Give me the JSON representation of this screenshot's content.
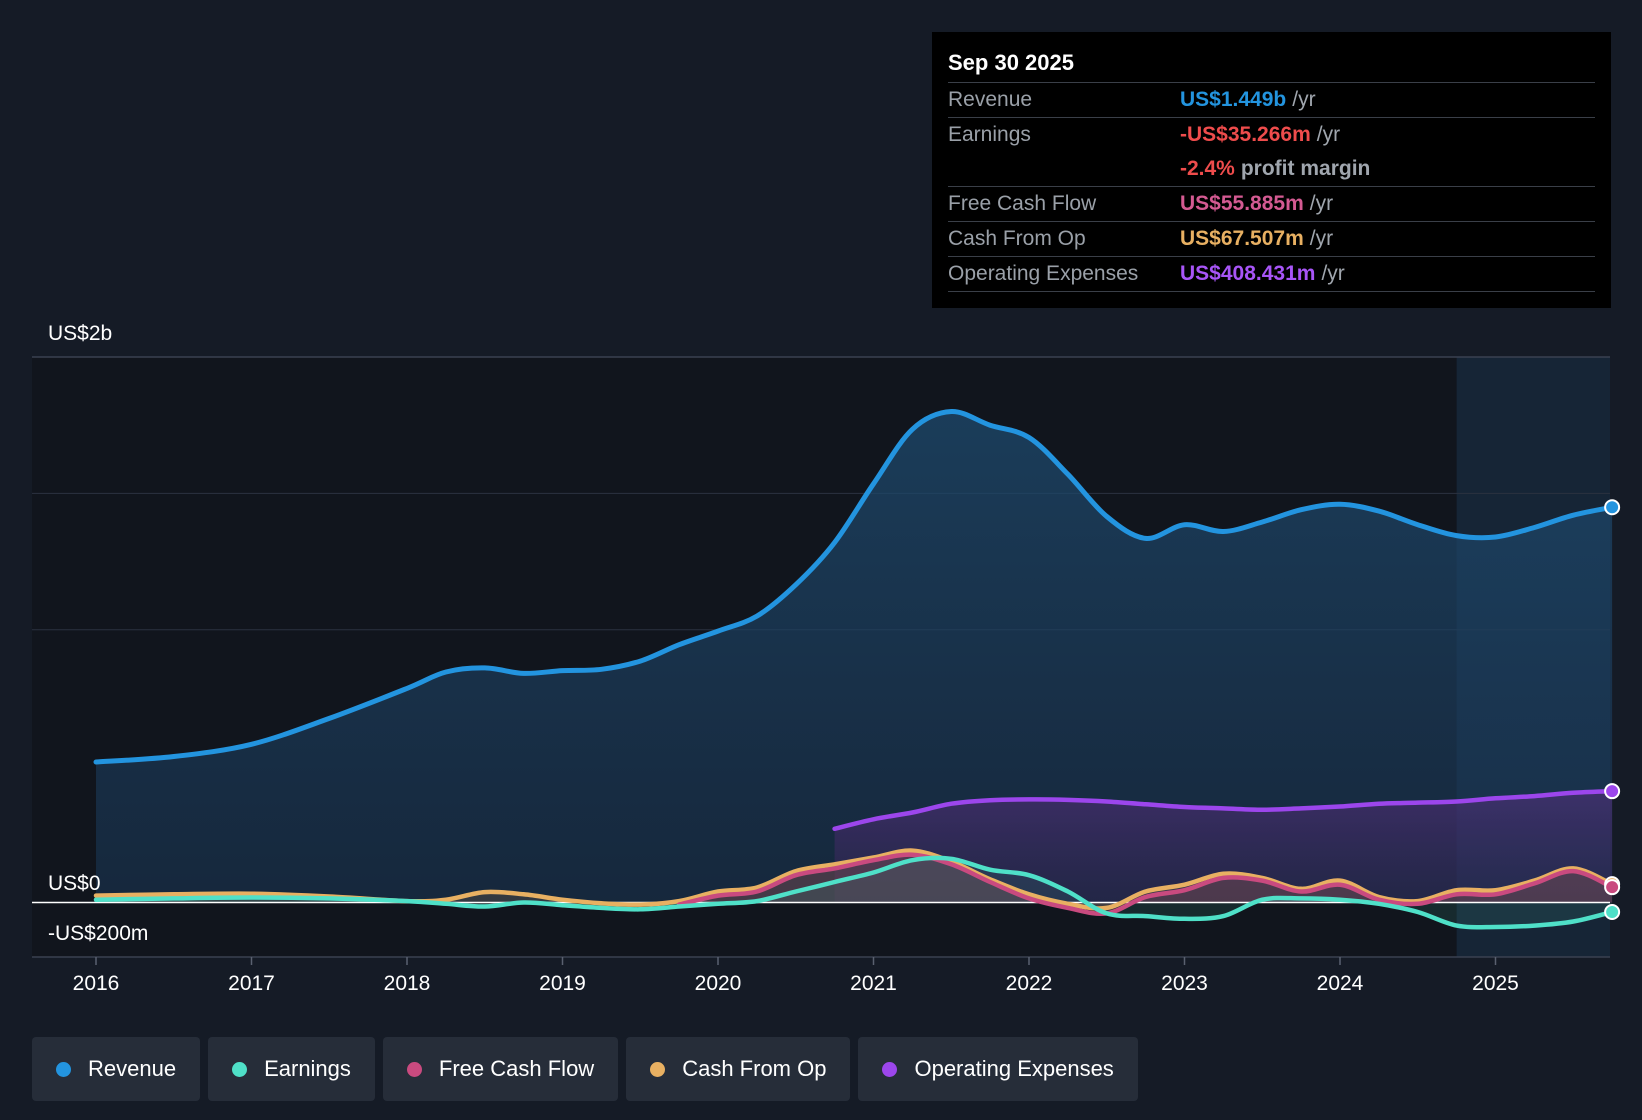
{
  "tooltip": {
    "date": "Sep 30 2025",
    "unit": "/yr",
    "rows": {
      "revenue": {
        "label": "Revenue",
        "value": "US$1.449b"
      },
      "earnings": {
        "label": "Earnings",
        "value": "-US$35.266m"
      },
      "margin": {
        "value": "-2.4%",
        "text": "profit margin"
      },
      "fcf": {
        "label": "Free Cash Flow",
        "value": "US$55.885m"
      },
      "cfo": {
        "label": "Cash From Op",
        "value": "US$67.507m"
      },
      "opex": {
        "label": "Operating Expenses",
        "value": "US$408.431m"
      }
    }
  },
  "legend": {
    "revenue": "Revenue",
    "earnings": "Earnings",
    "fcf": "Free Cash Flow",
    "cfo": "Cash From Op",
    "opex": "Operating Expenses"
  },
  "colors": {
    "revenue": "#2394df",
    "earnings": "#4fe0c8",
    "fcf": "#c94a7f",
    "cfo": "#e8b062",
    "opex": "#9c46ec"
  },
  "chart_data": {
    "type": "area",
    "y_axis_labels": {
      "top": "US$2b",
      "zero": "US$0",
      "bottom": "-US$200m"
    },
    "ylim": [
      -200,
      2000
    ],
    "units": "US$ millions (trailing twelve months)",
    "x_ticks": [
      "2016",
      "2017",
      "2018",
      "2019",
      "2020",
      "2021",
      "2022",
      "2023",
      "2024",
      "2025"
    ],
    "forecast_region_start": 2024.75,
    "grid": true,
    "series": [
      {
        "key": "revenue",
        "name": "Revenue",
        "points": [
          [
            2016.0,
            515
          ],
          [
            2016.5,
            535
          ],
          [
            2017.0,
            580
          ],
          [
            2017.5,
            675
          ],
          [
            2018.0,
            785
          ],
          [
            2018.25,
            845
          ],
          [
            2018.5,
            860
          ],
          [
            2018.75,
            840
          ],
          [
            2019.0,
            850
          ],
          [
            2019.25,
            855
          ],
          [
            2019.5,
            885
          ],
          [
            2019.75,
            945
          ],
          [
            2020.0,
            995
          ],
          [
            2020.25,
            1050
          ],
          [
            2020.5,
            1165
          ],
          [
            2020.75,
            1320
          ],
          [
            2021.0,
            1535
          ],
          [
            2021.25,
            1735
          ],
          [
            2021.5,
            1800
          ],
          [
            2021.75,
            1750
          ],
          [
            2022.0,
            1705
          ],
          [
            2022.25,
            1570
          ],
          [
            2022.5,
            1415
          ],
          [
            2022.75,
            1335
          ],
          [
            2023.0,
            1385
          ],
          [
            2023.25,
            1360
          ],
          [
            2023.5,
            1395
          ],
          [
            2023.75,
            1440
          ],
          [
            2024.0,
            1460
          ],
          [
            2024.25,
            1435
          ],
          [
            2024.5,
            1385
          ],
          [
            2024.75,
            1345
          ],
          [
            2025.0,
            1340
          ],
          [
            2025.25,
            1375
          ],
          [
            2025.5,
            1420
          ],
          [
            2025.75,
            1449
          ]
        ]
      },
      {
        "key": "opex",
        "name": "Operating Expenses",
        "points": [
          [
            2020.75,
            270
          ],
          [
            2021.0,
            305
          ],
          [
            2021.25,
            330
          ],
          [
            2021.5,
            362
          ],
          [
            2021.75,
            375
          ],
          [
            2022.0,
            378
          ],
          [
            2022.25,
            376
          ],
          [
            2022.5,
            370
          ],
          [
            2022.75,
            360
          ],
          [
            2023.0,
            350
          ],
          [
            2023.25,
            345
          ],
          [
            2023.5,
            340
          ],
          [
            2023.75,
            345
          ],
          [
            2024.0,
            352
          ],
          [
            2024.25,
            362
          ],
          [
            2024.5,
            366
          ],
          [
            2024.75,
            370
          ],
          [
            2025.0,
            382
          ],
          [
            2025.25,
            390
          ],
          [
            2025.5,
            402
          ],
          [
            2025.75,
            408
          ]
        ]
      },
      {
        "key": "cfo",
        "name": "Cash From Op",
        "points": [
          [
            2016.0,
            25
          ],
          [
            2016.5,
            30
          ],
          [
            2017.0,
            32
          ],
          [
            2017.5,
            22
          ],
          [
            2018.0,
            5
          ],
          [
            2018.25,
            10
          ],
          [
            2018.5,
            38
          ],
          [
            2018.75,
            30
          ],
          [
            2019.0,
            10
          ],
          [
            2019.25,
            -3
          ],
          [
            2019.5,
            -8
          ],
          [
            2019.75,
            5
          ],
          [
            2020.0,
            40
          ],
          [
            2020.25,
            55
          ],
          [
            2020.5,
            115
          ],
          [
            2020.75,
            140
          ],
          [
            2021.0,
            165
          ],
          [
            2021.25,
            190
          ],
          [
            2021.5,
            150
          ],
          [
            2021.75,
            85
          ],
          [
            2022.0,
            30
          ],
          [
            2022.25,
            -5
          ],
          [
            2022.5,
            -20
          ],
          [
            2022.75,
            40
          ],
          [
            2023.0,
            65
          ],
          [
            2023.25,
            105
          ],
          [
            2023.5,
            90
          ],
          [
            2023.75,
            50
          ],
          [
            2024.0,
            80
          ],
          [
            2024.25,
            20
          ],
          [
            2024.5,
            5
          ],
          [
            2024.75,
            45
          ],
          [
            2025.0,
            45
          ],
          [
            2025.25,
            80
          ],
          [
            2025.5,
            125
          ],
          [
            2025.75,
            67
          ]
        ]
      },
      {
        "key": "fcf",
        "name": "Free Cash Flow",
        "points": [
          [
            2019.75,
            -8
          ],
          [
            2020.0,
            25
          ],
          [
            2020.25,
            40
          ],
          [
            2020.5,
            100
          ],
          [
            2020.75,
            125
          ],
          [
            2021.0,
            155
          ],
          [
            2021.25,
            175
          ],
          [
            2021.5,
            140
          ],
          [
            2021.75,
            75
          ],
          [
            2022.0,
            15
          ],
          [
            2022.25,
            -20
          ],
          [
            2022.5,
            -40
          ],
          [
            2022.75,
            20
          ],
          [
            2023.0,
            45
          ],
          [
            2023.25,
            90
          ],
          [
            2023.5,
            80
          ],
          [
            2023.75,
            40
          ],
          [
            2024.0,
            65
          ],
          [
            2024.25,
            10
          ],
          [
            2024.5,
            -5
          ],
          [
            2024.75,
            30
          ],
          [
            2025.0,
            30
          ],
          [
            2025.25,
            70
          ],
          [
            2025.5,
            115
          ],
          [
            2025.75,
            56
          ]
        ]
      },
      {
        "key": "earnings",
        "name": "Earnings",
        "points": [
          [
            2016.0,
            10
          ],
          [
            2016.5,
            15
          ],
          [
            2017.0,
            18
          ],
          [
            2017.5,
            15
          ],
          [
            2018.0,
            5
          ],
          [
            2018.25,
            -5
          ],
          [
            2018.5,
            -15
          ],
          [
            2018.75,
            0
          ],
          [
            2019.0,
            -10
          ],
          [
            2019.25,
            -20
          ],
          [
            2019.5,
            -25
          ],
          [
            2019.75,
            -15
          ],
          [
            2020.0,
            -5
          ],
          [
            2020.25,
            5
          ],
          [
            2020.5,
            40
          ],
          [
            2020.75,
            75
          ],
          [
            2021.0,
            110
          ],
          [
            2021.25,
            155
          ],
          [
            2021.5,
            160
          ],
          [
            2021.75,
            120
          ],
          [
            2022.0,
            100
          ],
          [
            2022.25,
            40
          ],
          [
            2022.5,
            -40
          ],
          [
            2022.75,
            -50
          ],
          [
            2023.0,
            -60
          ],
          [
            2023.25,
            -50
          ],
          [
            2023.5,
            10
          ],
          [
            2023.75,
            15
          ],
          [
            2024.0,
            10
          ],
          [
            2024.25,
            -5
          ],
          [
            2024.5,
            -35
          ],
          [
            2024.75,
            -85
          ],
          [
            2025.0,
            -90
          ],
          [
            2025.25,
            -85
          ],
          [
            2025.5,
            -70
          ],
          [
            2025.75,
            -35
          ]
        ]
      }
    ]
  }
}
